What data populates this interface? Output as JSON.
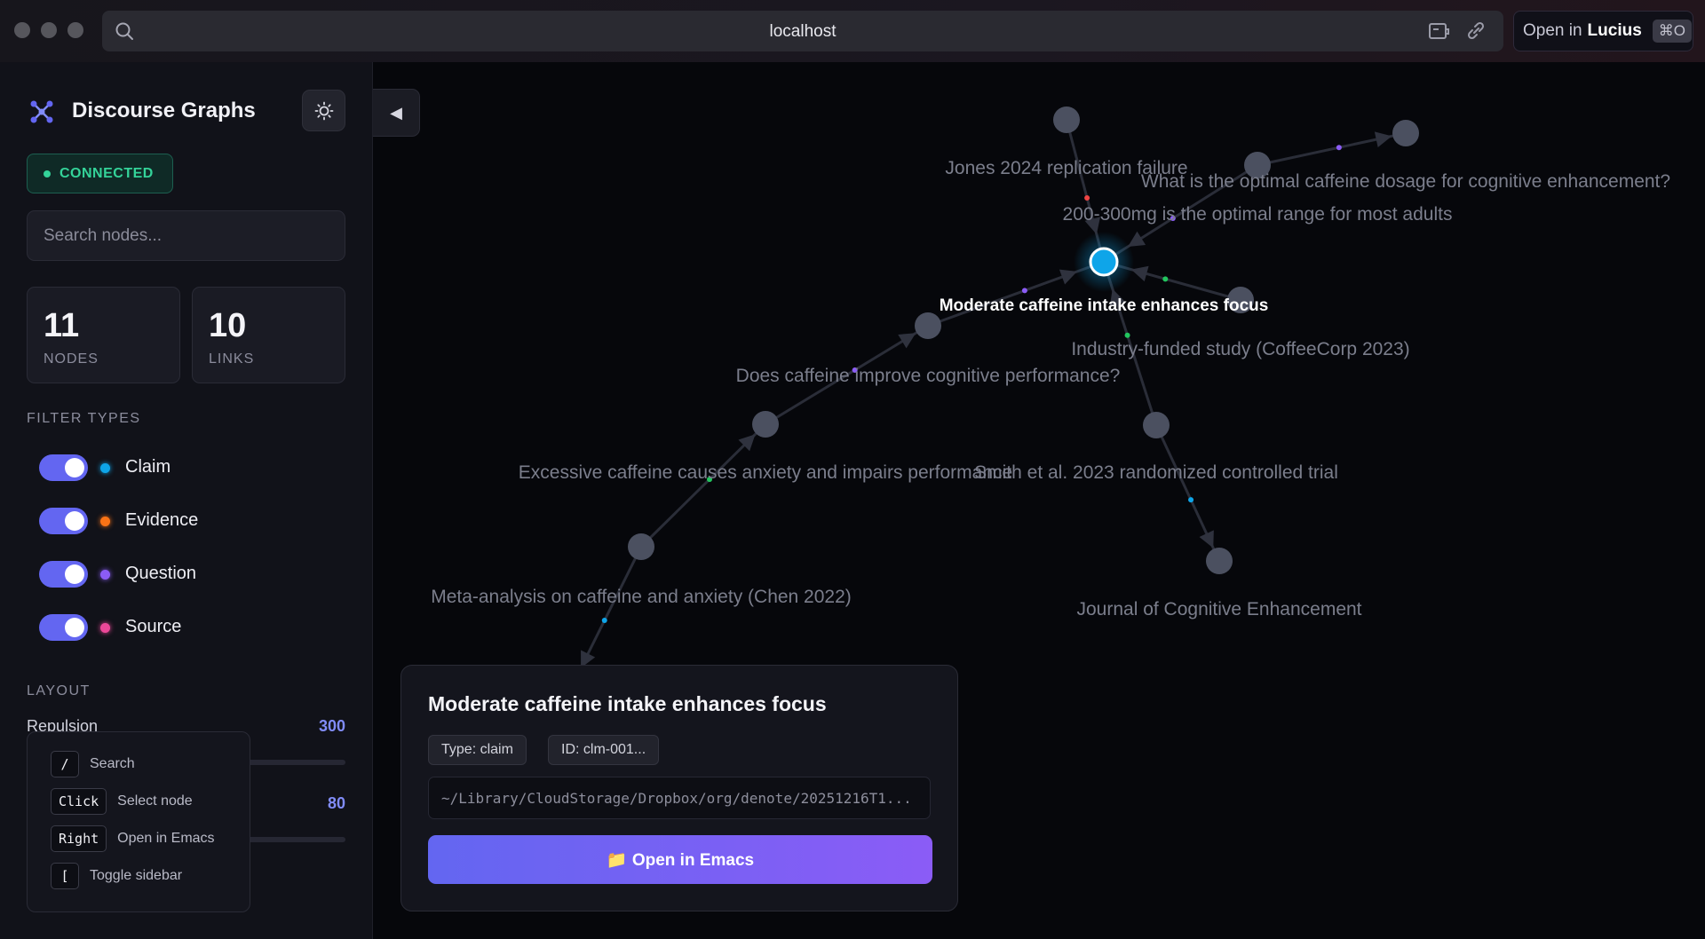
{
  "browser": {
    "url": "localhost",
    "open_in_prefix": "Open in",
    "open_in_app": "Lucius",
    "open_in_shortcut": "⌘O",
    "search_icon": "search-icon",
    "tools": [
      "extension-icon",
      "link-icon"
    ]
  },
  "sidebar": {
    "app_title": "Discourse Graphs",
    "app_icon": "graph-network-icon",
    "theme_icon": "sun-icon",
    "status": "CONNECTED",
    "status_color": "#34d399",
    "search_placeholder": "Search nodes...",
    "stats": [
      {
        "value": "11",
        "label": "NODES"
      },
      {
        "value": "10",
        "label": "LINKS"
      }
    ],
    "filter_title": "FILTER TYPES",
    "filters": [
      {
        "label": "Claim",
        "color": "#0ea5e9",
        "enabled": true
      },
      {
        "label": "Evidence",
        "color": "#f97316",
        "enabled": true
      },
      {
        "label": "Question",
        "color": "#8b5cf6",
        "enabled": true
      },
      {
        "label": "Source",
        "color": "#ec4899",
        "enabled": true
      }
    ],
    "layout_title": "LAYOUT",
    "layout": [
      {
        "label": "Repulsion",
        "value": "300"
      },
      {
        "label": "",
        "value": "80"
      }
    ],
    "shortcuts": [
      {
        "key": "/",
        "desc": "Search"
      },
      {
        "key": "Click",
        "desc": "Select node"
      },
      {
        "key": "Right",
        "desc": "Open in Emacs"
      },
      {
        "key": "[",
        "desc": "Toggle sidebar"
      }
    ],
    "collapse_glyph": "◀"
  },
  "graph": {
    "accent_color": "#0ea5e9",
    "node_color": "#4b5060",
    "nodes": [
      {
        "id": "n0",
        "label": "Moderate caffeine intake enhances focus",
        "selected": true
      },
      {
        "id": "n1",
        "label": "Jones 2024 replication failure"
      },
      {
        "id": "n2",
        "label": "200-300mg is the optimal range for most adults"
      },
      {
        "id": "n3",
        "label": "What is the optimal caffeine dosage for cognitive enhancement?"
      },
      {
        "id": "n4",
        "label": "Industry-funded study (CoffeeCorp 2023)"
      },
      {
        "id": "n5",
        "label": "Does caffeine improve cognitive performance?"
      },
      {
        "id": "n6",
        "label": "Excessive caffeine causes anxiety and impairs performance"
      },
      {
        "id": "n7",
        "label": "Smith et al. 2023 randomized controlled trial"
      },
      {
        "id": "n8",
        "label": "Meta-analysis on caffeine and anxiety (Chen 2022)"
      },
      {
        "id": "n9",
        "label": "Journal of Cognitive Enhancement"
      },
      {
        "id": "n10",
        "label": ""
      }
    ],
    "links": [
      {
        "source": "n1",
        "target": "n0",
        "color": "#ef4444"
      },
      {
        "source": "n2",
        "target": "n0",
        "color": "#8b5cf6"
      },
      {
        "source": "n2",
        "target": "n3",
        "color": "#8b5cf6"
      },
      {
        "source": "n4",
        "target": "n0",
        "color": "#22c55e"
      },
      {
        "source": "n5",
        "target": "n0",
        "color": "#8b5cf6"
      },
      {
        "source": "n6",
        "target": "n5",
        "color": "#8b5cf6"
      },
      {
        "source": "n7",
        "target": "n0",
        "color": "#22c55e"
      },
      {
        "source": "n8",
        "target": "n6",
        "color": "#22c55e"
      },
      {
        "source": "n7",
        "target": "n9",
        "color": "#0ea5e9"
      },
      {
        "source": "n8",
        "target": "n10",
        "color": "#0ea5e9"
      }
    ]
  },
  "detail": {
    "title": "Moderate caffeine intake enhances focus",
    "type_tag": "Type: claim",
    "id_tag": "ID: clm-001...",
    "path": "~/Library/CloudStorage/Dropbox/org/denote/20251216T1...",
    "open_button": "📁 Open in Emacs"
  }
}
